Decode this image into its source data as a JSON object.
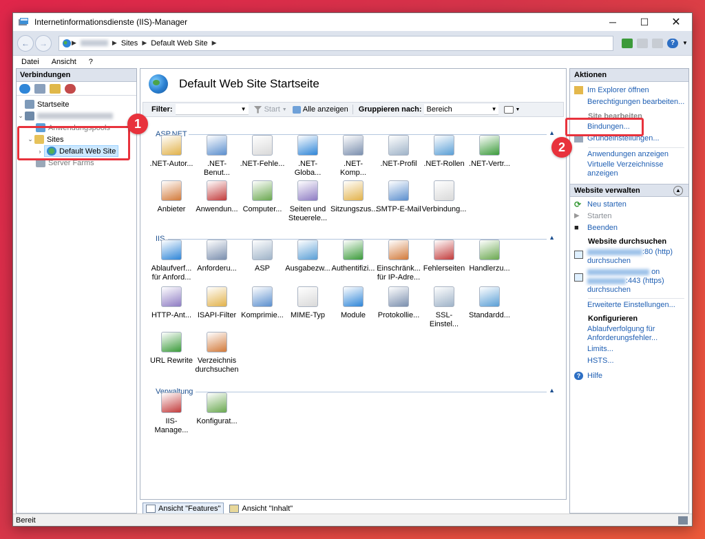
{
  "window": {
    "title": "Internetinformationsdienste (IIS)-Manager",
    "controls": {
      "minimize": "─",
      "maximize": "☐",
      "close": "✕"
    }
  },
  "address_bar": {
    "back": "←",
    "forward": "→",
    "crumbs": [
      "Sites",
      "Default Web Site"
    ],
    "help": "?"
  },
  "menu": [
    "Datei",
    "Ansicht",
    "?"
  ],
  "connections": {
    "header": "Verbindungen",
    "tree": {
      "start": "Startseite",
      "app_pools": "Anwendungspools",
      "sites": "Sites",
      "default_site": "Default Web Site",
      "server_farms": "Server Farms"
    }
  },
  "center": {
    "title": "Default Web Site Startseite",
    "filter": {
      "label": "Filter:",
      "start": "Start",
      "show_all": "Alle anzeigen",
      "group_label": "Gruppieren nach:",
      "group_value": "Bereich"
    },
    "groups": {
      "aspnet": "ASP.NET",
      "iis": "IIS",
      "verwaltung": "Verwaltung"
    },
    "features": {
      "aspnet": [
        ".NET-Autor...",
        ".NET-Benut...",
        ".NET-Fehle...",
        ".NET-Globa...",
        ".NET-Komp...",
        ".NET-Profil",
        ".NET-Rollen",
        ".NET-Vertr...",
        "Anbieter",
        "Anwendun...",
        "Computer...",
        "Seiten und Steuerele...",
        "Sitzungszus...",
        "SMTP-E-Mail",
        "Verbindung..."
      ],
      "iis": [
        "Ablaufverf... für Anford...",
        "Anforderu...",
        "ASP",
        "Ausgabezw...",
        "Authentifizi...",
        "Einschränk... für IP-Adre...",
        "Fehlerseiten",
        "Handlerzu...",
        "HTTP-Ant...",
        "ISAPI-Filter",
        "Komprimie...",
        "MIME-Typ",
        "Module",
        "Protokollie...",
        "SSL-Einstel...",
        "Standardd...",
        "URL Rewrite",
        "Verzeichnis durchsuchen"
      ],
      "verwaltung": [
        "IIS-Manage...",
        "Konfigurat..."
      ]
    },
    "tabs": {
      "features": "Ansicht \"Features\"",
      "content": "Ansicht \"Inhalt\""
    }
  },
  "actions": {
    "header": "Aktionen",
    "explore": "Im Explorer öffnen",
    "permissions": "Berechtigungen bearbeiten...",
    "site_edit_title": "Site bearbeiten",
    "bindings": "Bindungen...",
    "basic_settings": "Grundeinstellungen...",
    "view_apps": "Anwendungen anzeigen",
    "view_vdirs": "Virtuelle Verzeichnisse anzeigen",
    "manage_header": "Website verwalten",
    "restart": "Neu starten",
    "start": "Starten",
    "stop": "Beenden",
    "browse_title": "Website durchsuchen",
    "browse_http": ":80 (http)",
    "browse_http_suffix": "durchsuchen",
    "browse_https_on": "on",
    "browse_https": ":443 (https)",
    "browse_https_suffix": "durchsuchen",
    "advanced": "Erweiterte Einstellungen...",
    "configure_title": "Konfigurieren",
    "failed_tracing": "Ablaufverfolgung für Anforderungsfehler...",
    "limits": "Limits...",
    "hsts": "HSTS...",
    "help": "Hilfe"
  },
  "status": {
    "text": "Bereit"
  },
  "annotations": {
    "one": "1",
    "two": "2"
  },
  "colors": {
    "callout": "#e8323c",
    "link": "#1f5fb3",
    "group": "#1c4f8f"
  }
}
